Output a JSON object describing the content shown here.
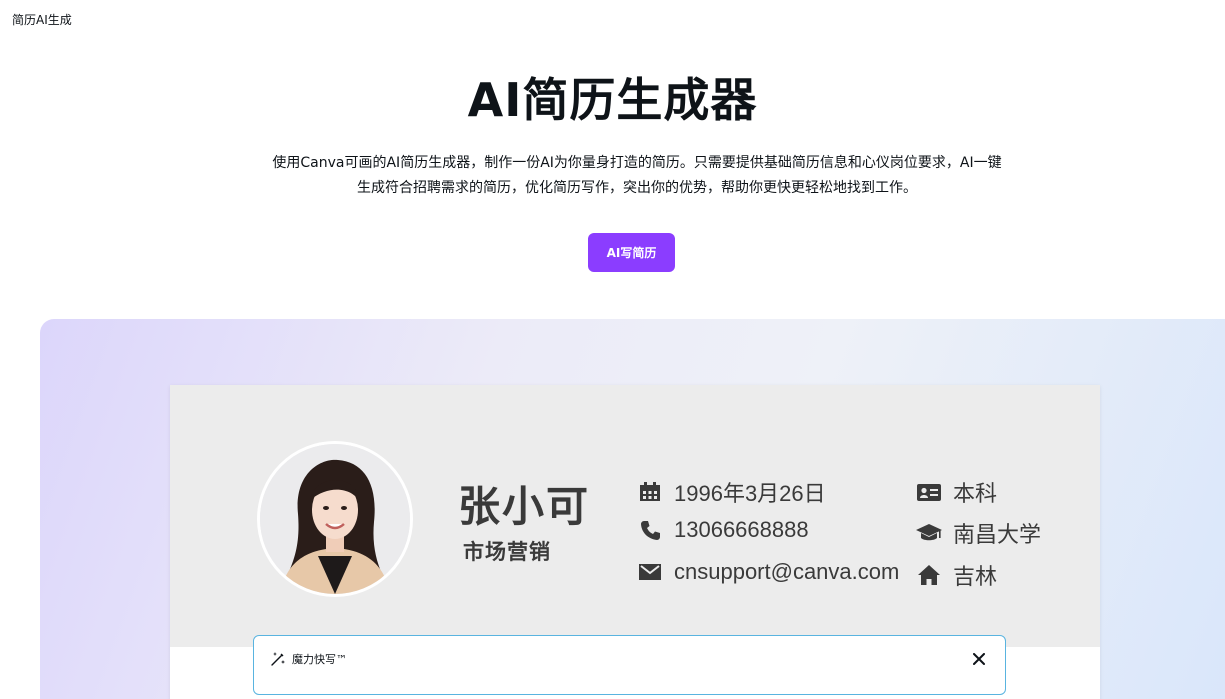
{
  "breadcrumb": "简历AI生成",
  "hero": {
    "title": "AI简历生成器",
    "description_line1": "使用Canva可画的AI简历生成器，制作一份AI为你量身打造的简历。只需要提供基础简历信息和心仪岗位要求，AI一键",
    "description_line2": "生成符合招聘需求的简历，优化简历写作，突出你的优势，帮助你更快更轻松地找到工作。",
    "cta_label": "AI写简历"
  },
  "colors": {
    "brand_purple": "#8b3dff",
    "text_dark": "#0e1318",
    "resume_text": "#3a3a3a",
    "magic_border": "#59b4e0"
  },
  "resume": {
    "name": "张小可",
    "role": "市场营销",
    "birthday": "1996年3月26日",
    "phone": "13066668888",
    "email": "cnsupport@canva.com",
    "education": "本科",
    "school": "南昌大学",
    "location": "吉林",
    "icons": {
      "birthday": "calendar-icon",
      "phone": "phone-icon",
      "email": "mail-icon",
      "education": "id-card-icon",
      "school": "graduation-cap-icon",
      "location": "home-icon"
    }
  },
  "magic_write": {
    "label": "魔力快写™",
    "close_glyph": "✕"
  }
}
